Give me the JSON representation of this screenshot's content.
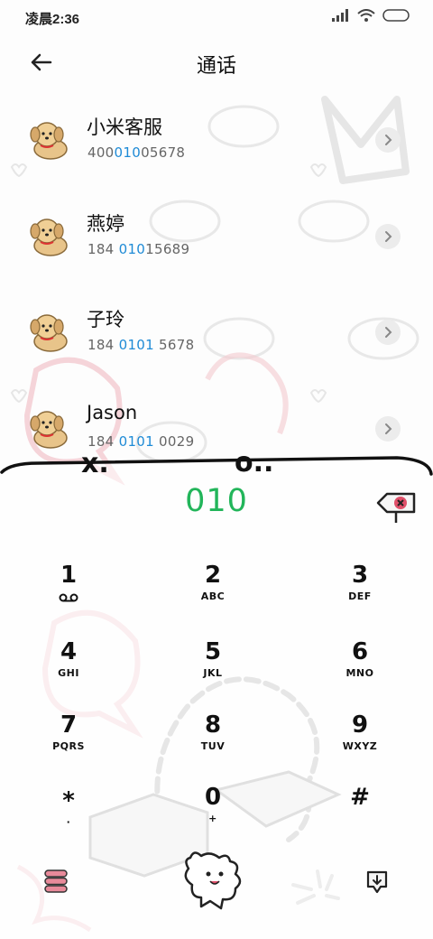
{
  "status": {
    "time": "凌晨2:36"
  },
  "header": {
    "title": "通话"
  },
  "contacts": [
    {
      "name": "小米客服",
      "num_pre": "400",
      "num_hl": "010",
      "num_post": "05678"
    },
    {
      "name": "燕婷",
      "num_pre": "184 ",
      "num_hl": "010",
      "num_post": "15689"
    },
    {
      "name": "子玲",
      "num_pre": "184 ",
      "num_hl": "0101",
      "num_post": " 5678"
    },
    {
      "name": "Jason",
      "num_pre": "184 ",
      "num_hl": "0101",
      "num_post": " 0029"
    }
  ],
  "dial": {
    "digits": "010"
  },
  "keys": [
    {
      "digit": "1",
      "letters": ""
    },
    {
      "digit": "2",
      "letters": "ABC"
    },
    {
      "digit": "3",
      "letters": "DEF"
    },
    {
      "digit": "4",
      "letters": "GHI"
    },
    {
      "digit": "5",
      "letters": "JKL"
    },
    {
      "digit": "6",
      "letters": "MNO"
    },
    {
      "digit": "7",
      "letters": "PQRS"
    },
    {
      "digit": "8",
      "letters": "TUV"
    },
    {
      "digit": "9",
      "letters": "WXYZ"
    },
    {
      "digit": "*",
      "letters": "·"
    },
    {
      "digit": "0",
      "letters": "+"
    },
    {
      "digit": "#",
      "letters": ""
    }
  ],
  "colors": {
    "accent": "#1f8bd6",
    "digits": "#22b55a",
    "delete": "#e0506a"
  },
  "icons": [
    "back-arrow-icon",
    "signal-icon",
    "wifi-icon",
    "battery-icon",
    "dog-avatar-icon",
    "chevron-right-icon",
    "delete-icon",
    "voicemail-icon",
    "menu-icon",
    "call-icon",
    "dialpad-hide-icon"
  ]
}
